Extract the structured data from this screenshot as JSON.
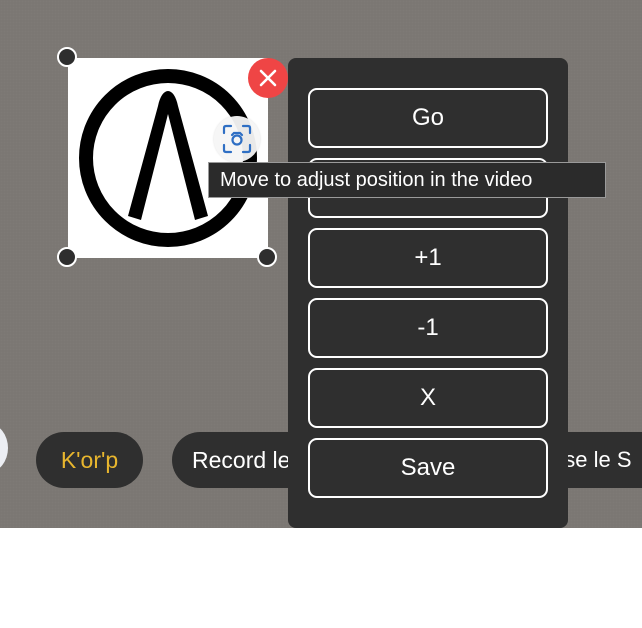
{
  "chips": {
    "korp_label": "K'or'p",
    "record_label": "Record le",
    "right_label": "ose le S"
  },
  "menu": {
    "go_label": "Go",
    "second_label": "",
    "plus_label": "+1",
    "minus_label": "-1",
    "x_label": "X",
    "save_label": "Save"
  },
  "tooltip": {
    "text": "Move to adjust position in the video"
  },
  "icons": {
    "close": "close-icon",
    "position": "focus-frame-icon",
    "sticker": "arch-in-circle-logo"
  },
  "colors": {
    "stage_background": "#7b7773",
    "panel": "#2f2f2f",
    "korp_text": "#e8b62e",
    "close_button": "#ef4545",
    "position_icon": "#2f6fc4"
  }
}
